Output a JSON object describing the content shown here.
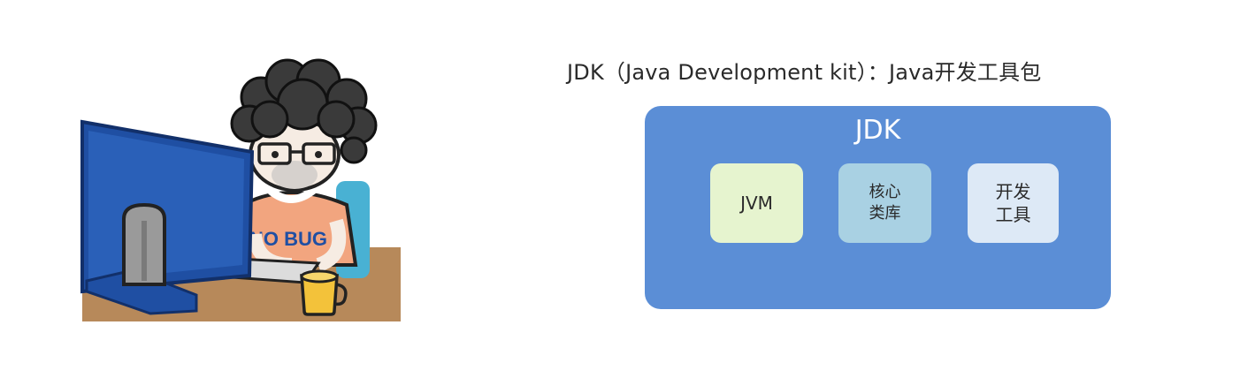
{
  "heading": "JDK（Java Development kit）：Java开发工具包",
  "jdk_box": {
    "title": "JDK",
    "components": [
      {
        "lines": [
          "JVM"
        ]
      },
      {
        "lines": [
          "核心",
          "类库"
        ]
      },
      {
        "lines": [
          "开发",
          "工具"
        ]
      }
    ]
  },
  "illustration": {
    "shirt_text": "NO BUG"
  },
  "colors": {
    "jdk_box": "#5b8ed6",
    "jvm": "#e6f4cf",
    "core_library": "#a9d1e3",
    "dev_tools": "#dde9f6",
    "monitor": "#1f4fa3",
    "desk": "#b7895a",
    "shirt": "#f2a57f",
    "mug": "#f3c23a"
  }
}
